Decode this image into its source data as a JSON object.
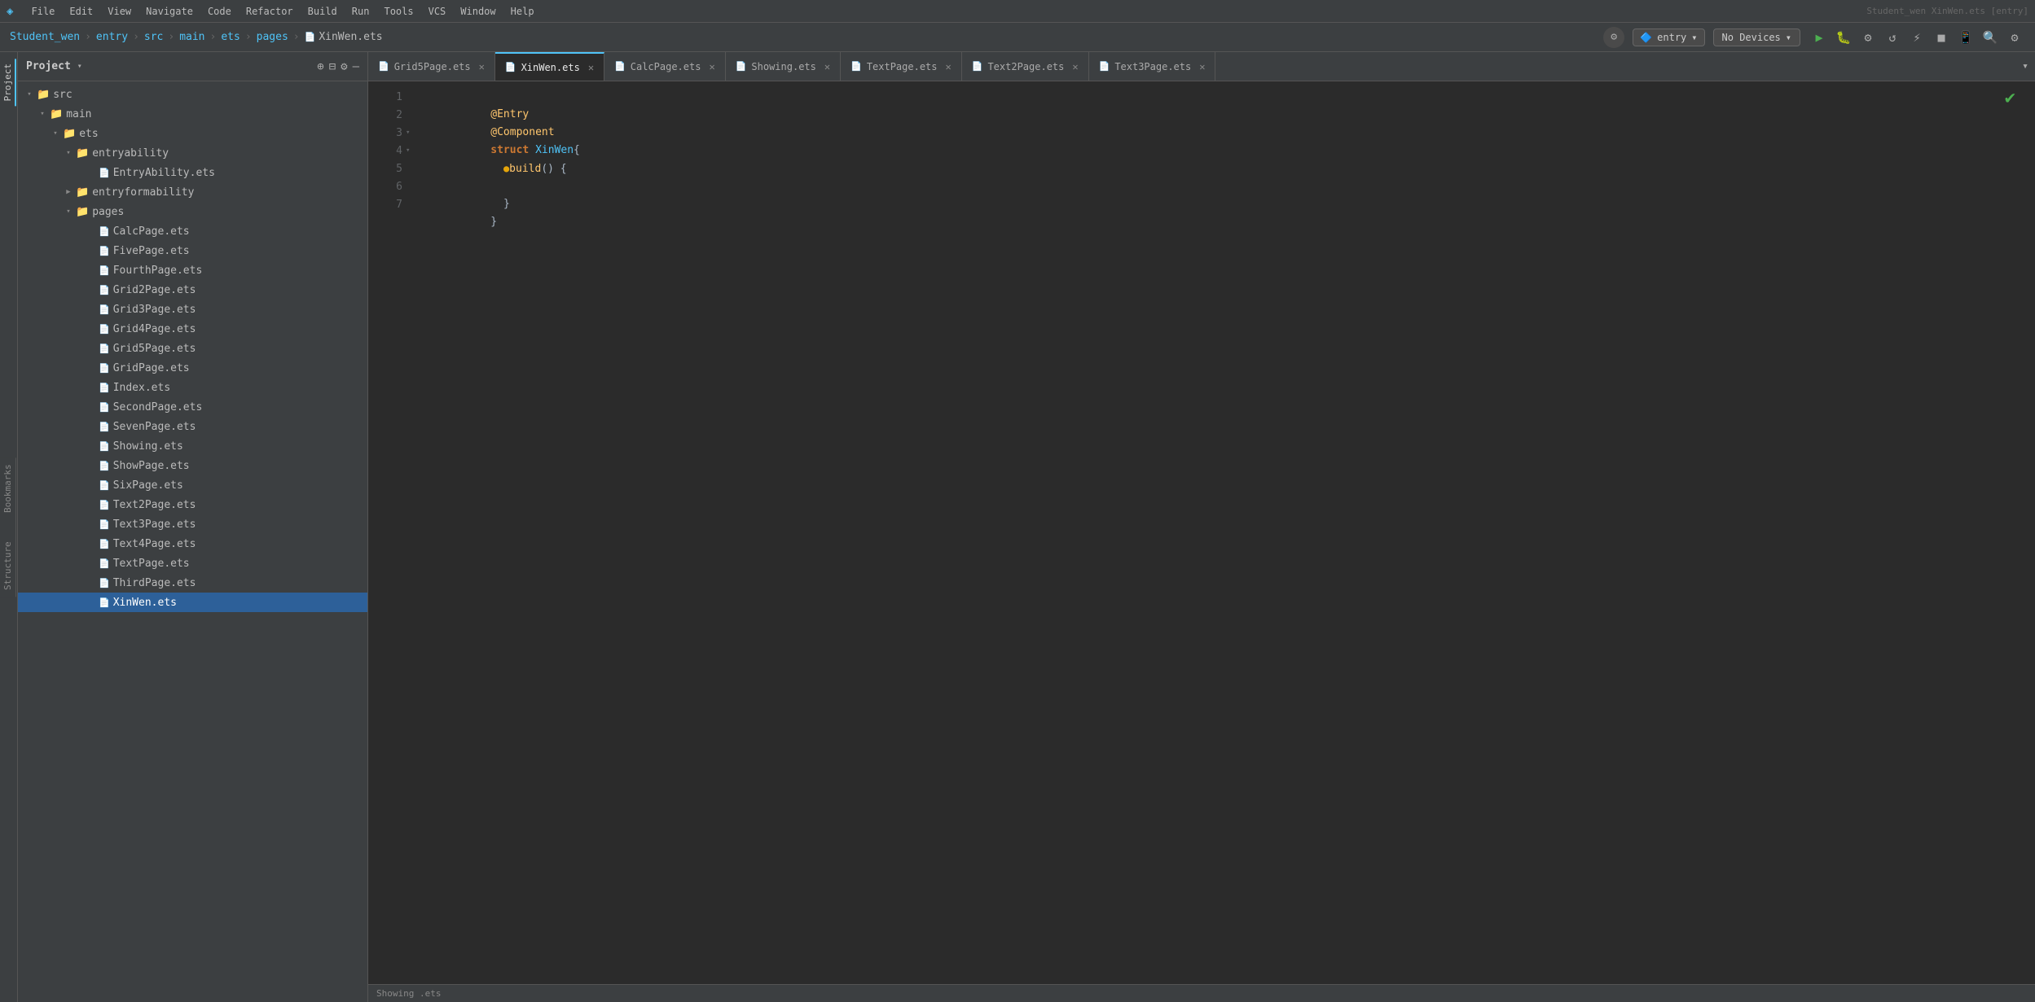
{
  "menubar": {
    "app_icon": "◈",
    "items": [
      "File",
      "Edit",
      "View",
      "Navigate",
      "Code",
      "Refactor",
      "Build",
      "Run",
      "Tools",
      "VCS",
      "Window",
      "Help"
    ],
    "right_info": "Student_wen  XinWen.ets [entry]"
  },
  "breadcrumb": {
    "items": [
      "Student_wen",
      "entry",
      "src",
      "main",
      "ets",
      "pages"
    ],
    "current_file_icon": "📄",
    "current_file": "XinWen.ets"
  },
  "toolbar": {
    "entry_label": "entry",
    "no_devices_label": "No Devices",
    "run_icon": "▶",
    "debug_icon": "🐛",
    "search_icon": "🔍",
    "settings_icon": "⚙"
  },
  "project_panel": {
    "title": "Project",
    "tree": [
      {
        "level": 0,
        "type": "folder",
        "open": true,
        "label": "src"
      },
      {
        "level": 1,
        "type": "folder",
        "open": true,
        "label": "main"
      },
      {
        "level": 2,
        "type": "folder",
        "open": true,
        "label": "ets"
      },
      {
        "level": 3,
        "type": "folder",
        "open": true,
        "label": "entryability"
      },
      {
        "level": 4,
        "type": "file",
        "label": "EntryAbility.ets"
      },
      {
        "level": 3,
        "type": "folder",
        "open": false,
        "label": "entryformability"
      },
      {
        "level": 3,
        "type": "folder",
        "open": true,
        "label": "pages"
      },
      {
        "level": 4,
        "type": "file",
        "label": "CalcPage.ets"
      },
      {
        "level": 4,
        "type": "file",
        "label": "FivePage.ets"
      },
      {
        "level": 4,
        "type": "file",
        "label": "FourthPage.ets"
      },
      {
        "level": 4,
        "type": "file",
        "label": "Grid2Page.ets"
      },
      {
        "level": 4,
        "type": "file",
        "label": "Grid3Page.ets"
      },
      {
        "level": 4,
        "type": "file",
        "label": "Grid4Page.ets"
      },
      {
        "level": 4,
        "type": "file",
        "label": "Grid5Page.ets"
      },
      {
        "level": 4,
        "type": "file",
        "label": "GridPage.ets"
      },
      {
        "level": 4,
        "type": "file",
        "label": "Index.ets"
      },
      {
        "level": 4,
        "type": "file",
        "label": "SecondPage.ets"
      },
      {
        "level": 4,
        "type": "file",
        "label": "SevenPage.ets"
      },
      {
        "level": 4,
        "type": "file",
        "label": "Showing.ets"
      },
      {
        "level": 4,
        "type": "file",
        "label": "ShowPage.ets"
      },
      {
        "level": 4,
        "type": "file",
        "label": "SixPage.ets"
      },
      {
        "level": 4,
        "type": "file",
        "label": "Text2Page.ets"
      },
      {
        "level": 4,
        "type": "file",
        "label": "Text3Page.ets"
      },
      {
        "level": 4,
        "type": "file",
        "label": "Text4Page.ets"
      },
      {
        "level": 4,
        "type": "file",
        "label": "TextPage.ets"
      },
      {
        "level": 4,
        "type": "file",
        "label": "ThirdPage.ets"
      },
      {
        "level": 4,
        "type": "file",
        "label": "XinWen.ets",
        "selected": true
      }
    ]
  },
  "editor_tabs": [
    {
      "label": "Grid5Page.ets",
      "active": false,
      "closeable": true
    },
    {
      "label": "XinWen.ets",
      "active": true,
      "closeable": true
    },
    {
      "label": "CalcPage.ets",
      "active": false,
      "closeable": true
    },
    {
      "label": "Showing.ets",
      "active": false,
      "closeable": true
    },
    {
      "label": "TextPage.ets",
      "active": false,
      "closeable": true
    },
    {
      "label": "Text2Page.ets",
      "active": false,
      "closeable": true
    },
    {
      "label": "Text3Page.ets",
      "active": false,
      "closeable": true
    }
  ],
  "editor": {
    "filename": "XinWen.ets",
    "lines": [
      {
        "num": 1,
        "fold": false,
        "content": [
          {
            "type": "annotation",
            "text": "@Entry"
          }
        ]
      },
      {
        "num": 2,
        "fold": false,
        "content": [
          {
            "type": "annotation",
            "text": "@Component"
          }
        ]
      },
      {
        "num": 3,
        "fold": true,
        "content": [
          {
            "type": "keyword",
            "text": "struct"
          },
          {
            "type": "space",
            "text": " "
          },
          {
            "type": "typename",
            "text": "XinWen"
          },
          {
            "type": "brace",
            "text": "{"
          }
        ]
      },
      {
        "num": 4,
        "fold": true,
        "content": [
          {
            "type": "indent2"
          },
          {
            "type": "dot-icon",
            "text": "●"
          },
          {
            "type": "keyword2",
            "text": "build"
          },
          {
            "type": "paren",
            "text": "()"
          },
          {
            "type": "space",
            "text": " "
          },
          {
            "type": "brace",
            "text": "{"
          }
        ]
      },
      {
        "num": 5,
        "fold": false,
        "content": []
      },
      {
        "num": 6,
        "fold": false,
        "content": [
          {
            "type": "indent4"
          },
          {
            "type": "brace",
            "text": "}"
          }
        ]
      },
      {
        "num": 7,
        "fold": false,
        "content": [
          {
            "type": "indent2"
          },
          {
            "type": "brace",
            "text": "}"
          }
        ]
      }
    ]
  },
  "sidebar_tabs": {
    "left": [
      "Project",
      "Bookmarks",
      "Structure"
    ],
    "right": []
  },
  "bottom_bar": {
    "showing_label": "Showing .ets"
  }
}
